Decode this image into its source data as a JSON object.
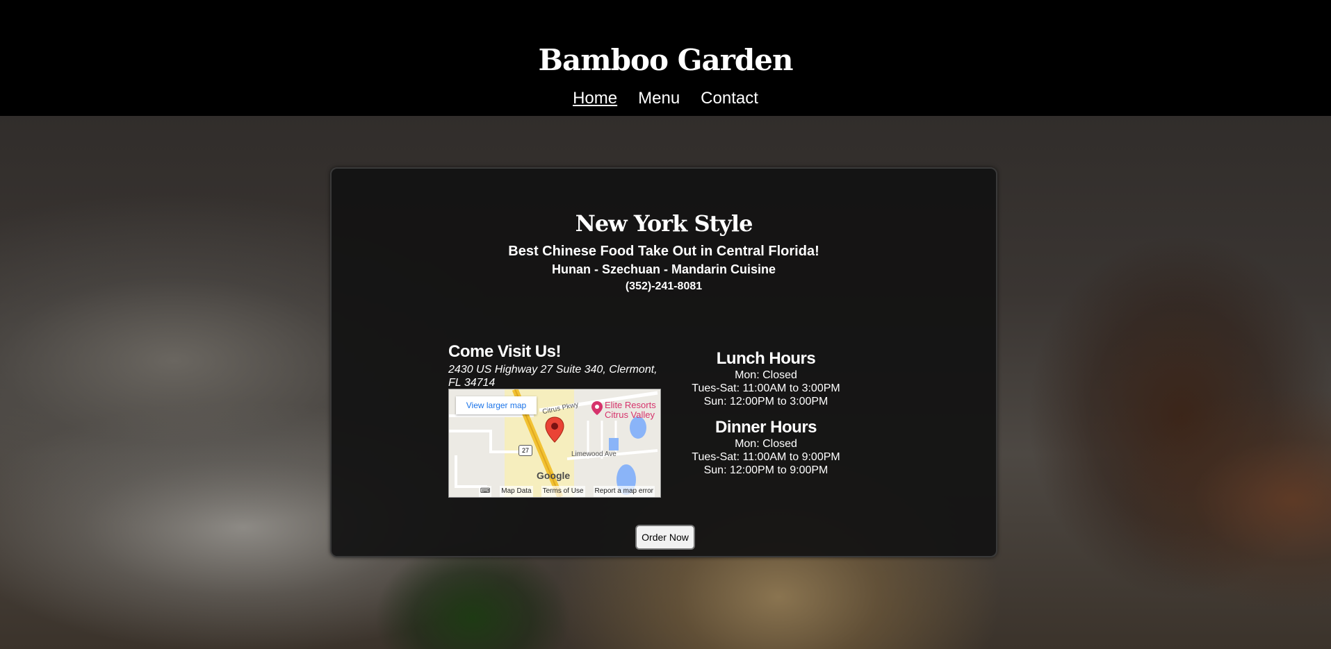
{
  "site": {
    "title": "Bamboo Garden"
  },
  "nav": {
    "items": [
      {
        "label": "Home",
        "active": true
      },
      {
        "label": "Menu",
        "active": false
      },
      {
        "label": "Contact",
        "active": false
      }
    ]
  },
  "hero": {
    "title": "New York Style",
    "tagline": "Best Chinese Food Take Out in Central Florida!",
    "cuisine": "Hunan - Szechuan - Mandarin Cuisine",
    "phone": "(352)-241-8081"
  },
  "visit": {
    "heading": "Come Visit Us!",
    "address": "2430 US Highway 27 Suite 340, Clermont, FL 34714"
  },
  "map": {
    "larger_map_label": "View larger map",
    "poi_line1": "Elite Resorts",
    "poi_line2": "Citrus Valley",
    "street_label_1": "Citrus Pkwy",
    "street_label_2": "Limewood Ave",
    "route_label": "27",
    "logo": "Google",
    "footer": {
      "data": "Map Data",
      "terms": "Terms of Use",
      "report": "Report a map error"
    }
  },
  "hours": {
    "lunch": {
      "heading": "Lunch Hours",
      "lines": [
        "Mon: Closed",
        "Tues-Sat: 11:00AM to 3:00PM",
        "Sun: 12:00PM to 3:00PM"
      ]
    },
    "dinner": {
      "heading": "Dinner Hours",
      "lines": [
        "Mon: Closed",
        "Tues-Sat: 11:00AM to 9:00PM",
        "Sun: 12:00PM to 9:00PM"
      ]
    }
  },
  "order": {
    "button_label": "Order Now"
  },
  "colors": {
    "header_bg": "#000000",
    "card_bg": "#121212",
    "text": "#ffffff",
    "map_link": "#1a73e8",
    "map_poi": "#d6336c"
  }
}
